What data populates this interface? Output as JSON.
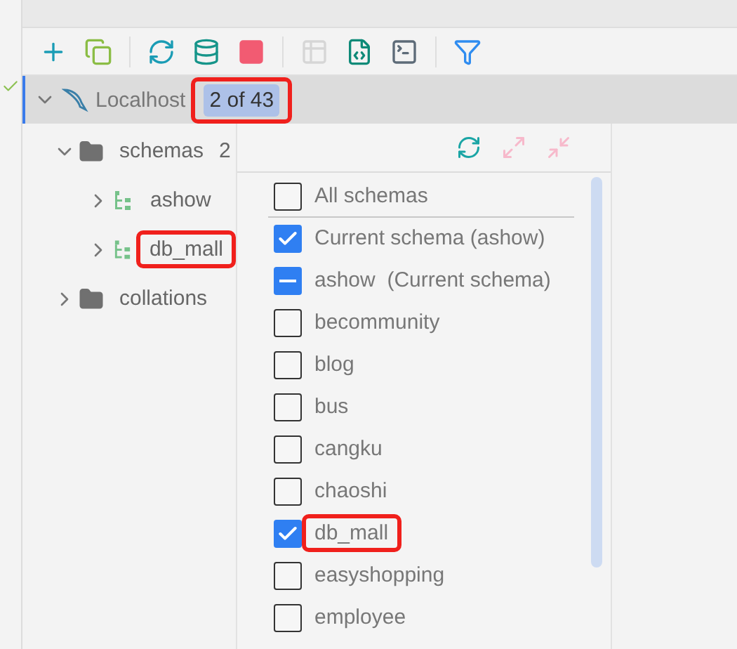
{
  "toolbar": [
    [
      {
        "kind": "add",
        "disabled": false
      },
      {
        "kind": "copy",
        "disabled": false
      }
    ],
    [
      {
        "kind": "refresh",
        "disabled": false
      },
      {
        "kind": "db-search",
        "disabled": false
      },
      {
        "kind": "stop",
        "disabled": false
      }
    ],
    [
      {
        "kind": "table",
        "disabled": true
      },
      {
        "kind": "script",
        "disabled": false
      },
      {
        "kind": "console",
        "disabled": false
      }
    ],
    [
      {
        "kind": "filter",
        "disabled": false
      }
    ]
  ],
  "connection": {
    "name": "Localhost",
    "badge": "2 of 43",
    "expanded": true,
    "highlighted": true
  },
  "tree": [
    {
      "label": "schemas",
      "count": "2",
      "kind": "folder",
      "expanded": true,
      "highlighted": false,
      "children": [
        {
          "label": "ashow",
          "kind": "schema",
          "expanded": false,
          "highlighted": false
        },
        {
          "label": "db_mall",
          "kind": "schema",
          "expanded": false,
          "highlighted": true
        }
      ]
    },
    {
      "label": "collations",
      "kind": "folder",
      "expanded": false,
      "highlighted": false
    }
  ],
  "popup": {
    "actions": [
      {
        "kind": "refresh",
        "disabled": false
      },
      {
        "kind": "expand",
        "disabled": true
      },
      {
        "kind": "collapse",
        "disabled": true
      }
    ],
    "options": [
      {
        "label": "All schemas",
        "checked": false,
        "partial": false,
        "highlighted": false,
        "divider_after": true
      },
      {
        "label": "Current schema (ashow)",
        "checked": true,
        "partial": false,
        "highlighted": false,
        "divider_after": false
      },
      {
        "label": "ashow  (Current schema)",
        "checked": false,
        "partial": true,
        "highlighted": false,
        "divider_after": false
      },
      {
        "label": "becommunity",
        "checked": false,
        "partial": false,
        "highlighted": false,
        "divider_after": false
      },
      {
        "label": "blog",
        "checked": false,
        "partial": false,
        "highlighted": false,
        "divider_after": false
      },
      {
        "label": "bus",
        "checked": false,
        "partial": false,
        "highlighted": false,
        "divider_after": false
      },
      {
        "label": "cangku",
        "checked": false,
        "partial": false,
        "highlighted": false,
        "divider_after": false
      },
      {
        "label": "chaoshi",
        "checked": false,
        "partial": false,
        "highlighted": false,
        "divider_after": false
      },
      {
        "label": "db_mall",
        "checked": true,
        "partial": false,
        "highlighted": true,
        "divider_after": false
      },
      {
        "label": "easyshopping",
        "checked": false,
        "partial": false,
        "highlighted": false,
        "divider_after": false
      },
      {
        "label": "employee",
        "checked": false,
        "partial": false,
        "highlighted": false,
        "divider_after": false
      }
    ]
  }
}
